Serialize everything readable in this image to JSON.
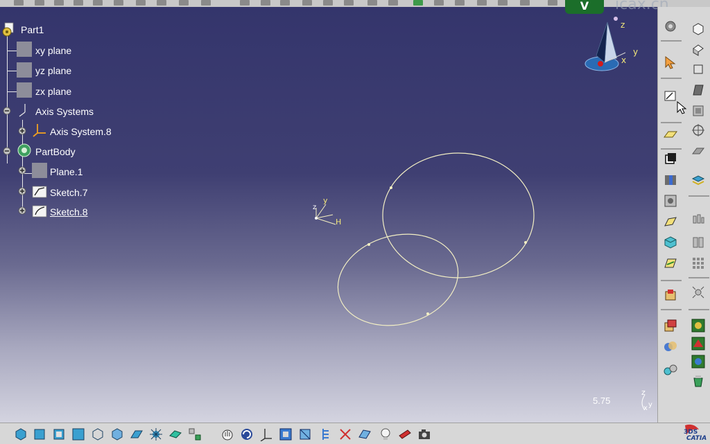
{
  "tree": {
    "root": "Part1",
    "items": [
      {
        "label": "xy plane",
        "icon": "plane-icon"
      },
      {
        "label": "yz plane",
        "icon": "plane-icon"
      },
      {
        "label": "zx plane",
        "icon": "plane-icon"
      },
      {
        "label": "Axis Systems",
        "icon": "axis-systems-icon"
      },
      {
        "label": "Axis System.8",
        "icon": "axis-system-icon"
      },
      {
        "label": "PartBody",
        "icon": "partbody-icon"
      },
      {
        "label": "Plane.1",
        "icon": "plane-icon"
      },
      {
        "label": "Sketch.7",
        "icon": "sketch-icon"
      },
      {
        "label": "Sketch.8",
        "icon": "sketch-icon"
      }
    ]
  },
  "viewport": {
    "zoom_readout": "5.75",
    "compass_labels": {
      "z": "z",
      "x": "x",
      "y": "y"
    },
    "sketch_axis_labels": {
      "z": "z",
      "y": "y",
      "h": "H"
    },
    "mini_axis_labels": {
      "z": "z",
      "x": "x",
      "y": "y"
    }
  },
  "branding": {
    "badge": "V",
    "watermark": "icax.cn",
    "logo": "CATIA",
    "logo_prefix": "3DS"
  },
  "colors": {
    "viewport_top": "#34356c",
    "viewport_bottom": "#d4d4e0",
    "sketch_curve": "#f3efc4",
    "toolbar_bg": "#d7d7d7"
  }
}
